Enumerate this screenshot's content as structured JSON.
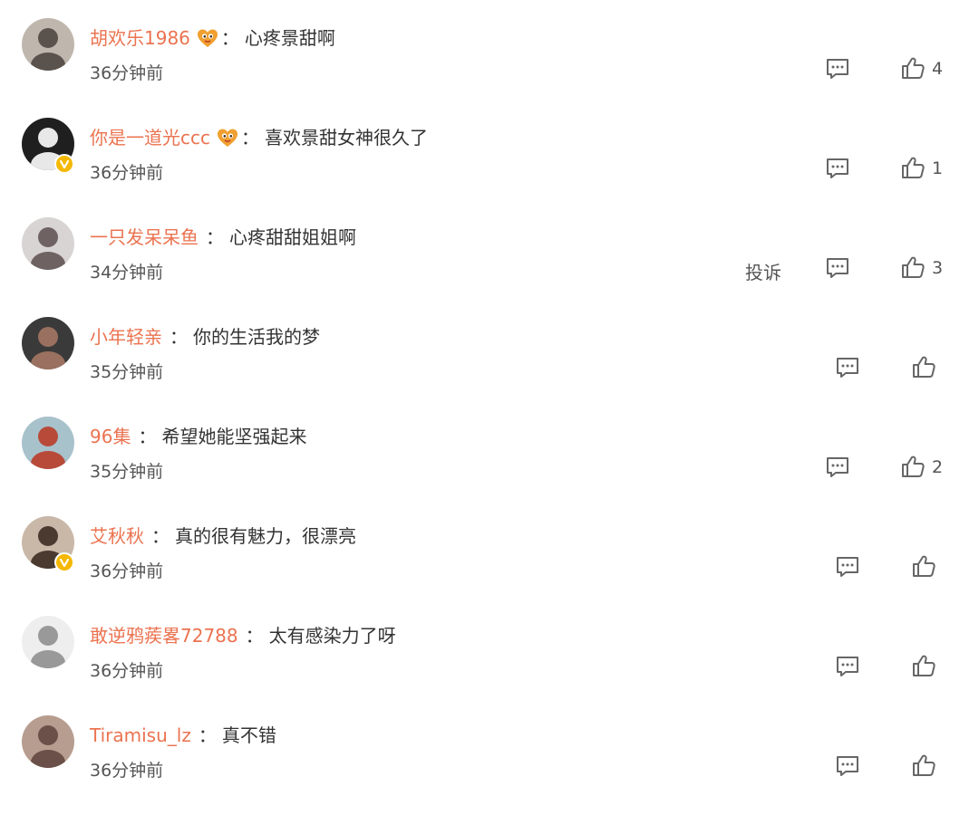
{
  "comments": [
    {
      "user": "胡欢乐1986",
      "fan_badge": true,
      "text": "心疼景甜啊",
      "time": "36分钟前",
      "likes": "4",
      "avatar": {
        "bg": "#bfb7ad",
        "fg": "#5a524c"
      }
    },
    {
      "user": "你是一道光ccc",
      "fan_badge": true,
      "text": "喜欢景甜女神很久了",
      "time": "36分钟前",
      "likes": "1",
      "verified": true,
      "avatar": {
        "bg": "#1f1f1f",
        "fg": "#e8e8e8"
      }
    },
    {
      "user": "一只发呆呆鱼",
      "text": "心疼甜甜姐姐啊",
      "time": "34分钟前",
      "likes": "3",
      "report": "投诉",
      "avatar": {
        "bg": "#d9d4d4",
        "fg": "#6e6262"
      }
    },
    {
      "user": "小年轻亲",
      "text": "你的生活我的梦",
      "time": "35分钟前",
      "likes": "",
      "avatar": {
        "bg": "#3a3a3a",
        "fg": "#9a7060"
      }
    },
    {
      "user": "96集",
      "text": "希望她能坚强起来",
      "time": "35分钟前",
      "likes": "2",
      "avatar": {
        "bg": "#a8c2cc",
        "fg": "#b84a3a"
      }
    },
    {
      "user": "艾秋秋",
      "text": "真的很有魅力，很漂亮",
      "time": "36分钟前",
      "likes": "",
      "verified": true,
      "avatar": {
        "bg": "#c9b8a8",
        "fg": "#4a3a30"
      }
    },
    {
      "user": "敢逆鸦蒺畧72788",
      "text": "太有感染力了呀",
      "time": "36分钟前",
      "likes": "",
      "avatar": {
        "bg": "#eeeeee",
        "fg": "#999999"
      }
    },
    {
      "user": "Tiramisu_lz",
      "text": "真不错",
      "time": "36分钟前",
      "likes": "",
      "avatar": {
        "bg": "#b79d90",
        "fg": "#6a5048"
      }
    }
  ],
  "colors": {
    "username": "#eb7350",
    "text": "#333333",
    "meta": "#555555",
    "icon": "#666666",
    "verified": "#f5b800"
  },
  "icons": {
    "reply": "comment-bubble-icon",
    "like": "thumbs-up-icon",
    "verified": "verified-v-icon",
    "fan": "fan-badge-icon"
  }
}
